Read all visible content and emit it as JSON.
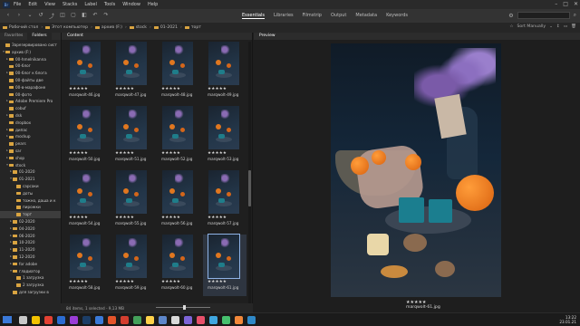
{
  "app": {
    "logo": "Br"
  },
  "menu": [
    "File",
    "Edit",
    "View",
    "Stacks",
    "Label",
    "Tools",
    "Window",
    "Help"
  ],
  "workspaces": [
    {
      "label": "Essentials",
      "active": true
    },
    {
      "label": "Libraries",
      "active": false
    },
    {
      "label": "Filmstrip",
      "active": false
    },
    {
      "label": "Output",
      "active": false
    },
    {
      "label": "Metadata",
      "active": false
    },
    {
      "label": "Keywords",
      "active": false
    }
  ],
  "breadcrumbs": [
    "Рабочий стол",
    "Этот компьютер",
    "архив (F:)",
    "stock",
    "01-2021",
    "торт"
  ],
  "sort": {
    "label": "Sort Manually"
  },
  "tabs": {
    "favorites": "Favorites",
    "folders": "Folders",
    "content": "Content",
    "preview": "Preview"
  },
  "tree": [
    {
      "label": "Зарезервировано сист",
      "depth": 0,
      "arrow": "",
      "selected": false
    },
    {
      "label": "архив (F:)",
      "depth": 0,
      "arrow": "▾",
      "selected": false
    },
    {
      "label": "00-hmelnikanna",
      "depth": 1,
      "arrow": "▸",
      "selected": false
    },
    {
      "label": "00-блог",
      "depth": 1,
      "arrow": "",
      "selected": false
    },
    {
      "label": "00-блог к блога",
      "depth": 1,
      "arrow": "▸",
      "selected": false
    },
    {
      "label": "00-файты две",
      "depth": 1,
      "arrow": "",
      "selected": false
    },
    {
      "label": "00-в-марафоне",
      "depth": 1,
      "arrow": "",
      "selected": false
    },
    {
      "label": "00-фото",
      "depth": 1,
      "arrow": "",
      "selected": false
    },
    {
      "label": "Adobe Premiere Pro",
      "depth": 1,
      "arrow": "▸",
      "selected": false
    },
    {
      "label": "cobuf",
      "depth": 1,
      "arrow": "",
      "selected": false
    },
    {
      "label": "dsk",
      "depth": 1,
      "arrow": "▸",
      "selected": false
    },
    {
      "label": "dropbox",
      "depth": 1,
      "arrow": "",
      "selected": false
    },
    {
      "label": "дипас",
      "depth": 1,
      "arrow": "▸",
      "selected": false
    },
    {
      "label": "mockup",
      "depth": 1,
      "arrow": "▸",
      "selected": false
    },
    {
      "label": "pears",
      "depth": 1,
      "arrow": "",
      "selected": false
    },
    {
      "label": "sar",
      "depth": 1,
      "arrow": "▸",
      "selected": false
    },
    {
      "label": "shop",
      "depth": 1,
      "arrow": "▸",
      "selected": false
    },
    {
      "label": "stock",
      "depth": 1,
      "arrow": "▾",
      "selected": false
    },
    {
      "label": "01-2020",
      "depth": 2,
      "arrow": "▸",
      "selected": false
    },
    {
      "label": "01-2021",
      "depth": 2,
      "arrow": "▾",
      "selected": false
    },
    {
      "label": "сарсаки",
      "depth": 3,
      "arrow": "",
      "selected": false
    },
    {
      "label": "доты",
      "depth": 3,
      "arrow": "",
      "selected": false
    },
    {
      "label": "тожно, даша и к",
      "depth": 3,
      "arrow": "",
      "selected": false
    },
    {
      "label": "пирожки",
      "depth": 3,
      "arrow": "",
      "selected": false
    },
    {
      "label": "торт",
      "depth": 3,
      "arrow": "",
      "selected": true
    },
    {
      "label": "02-2020",
      "depth": 2,
      "arrow": "▸",
      "selected": false
    },
    {
      "label": "04-2020",
      "depth": 2,
      "arrow": "▸",
      "selected": false
    },
    {
      "label": "06-2020",
      "depth": 2,
      "arrow": "▸",
      "selected": false
    },
    {
      "label": "10-2020",
      "depth": 2,
      "arrow": "▸",
      "selected": false
    },
    {
      "label": "11-2020",
      "depth": 2,
      "arrow": "▸",
      "selected": false
    },
    {
      "label": "12-2020",
      "depth": 2,
      "arrow": "▸",
      "selected": false
    },
    {
      "label": "for adobe",
      "depth": 2,
      "arrow": "▸",
      "selected": false
    },
    {
      "label": "гладиатор",
      "depth": 2,
      "arrow": "▾",
      "selected": false
    },
    {
      "label": "1 загрузка",
      "depth": 3,
      "arrow": "",
      "selected": false
    },
    {
      "label": "2 загрузка",
      "depth": 3,
      "arrow": "",
      "selected": false
    },
    {
      "label": "для загрузки в",
      "depth": 2,
      "arrow": "",
      "selected": false
    }
  ],
  "thumbnails": [
    {
      "name": "marqwolt-46.jpg",
      "stars": "★★★★★",
      "selected": false
    },
    {
      "name": "marqwolt-47.jpg",
      "stars": "★★★★★",
      "selected": false
    },
    {
      "name": "marqwolt-48.jpg",
      "stars": "★★★★★",
      "selected": false
    },
    {
      "name": "marqwolt-49.jpg",
      "stars": "★★★★★",
      "selected": false
    },
    {
      "name": "marqwolt-50.jpg",
      "stars": "★★★★★",
      "selected": false
    },
    {
      "name": "marqwolt-51.jpg",
      "stars": "★★★★★",
      "selected": false
    },
    {
      "name": "marqwolt-52.jpg",
      "stars": "★★★★★",
      "selected": false
    },
    {
      "name": "marqwolt-53.jpg",
      "stars": "★★★★★",
      "selected": false
    },
    {
      "name": "marqwolt-54.jpg",
      "stars": "★★★★★",
      "selected": false
    },
    {
      "name": "marqwolt-55.jpg",
      "stars": "★★★★★",
      "selected": false
    },
    {
      "name": "marqwolt-56.jpg",
      "stars": "★★★★★",
      "selected": false
    },
    {
      "name": "marqwolt-57.jpg",
      "stars": "★★★★★",
      "selected": false
    },
    {
      "name": "marqwolt-58.jpg",
      "stars": "★★★★★",
      "selected": false
    },
    {
      "name": "marqwolt-59.jpg",
      "stars": "★★★★★",
      "selected": false
    },
    {
      "name": "marqwolt-60.jpg",
      "stars": "★★★★★",
      "selected": false
    },
    {
      "name": "marqwolt-61.jpg",
      "stars": "★★★★★",
      "selected": true
    }
  ],
  "status": {
    "text": "84 items, 1 selected - 9,13 MB"
  },
  "preview": {
    "stars": "★★★★★",
    "name": "marqwolt-61.jpg"
  },
  "tray": {
    "time": "13:22",
    "date": "23.01.21"
  },
  "colors": {
    "accent": "#8fb3e6",
    "folder": "#d9a441",
    "cake": "#1b7e8f",
    "orange": "#e0771f"
  }
}
